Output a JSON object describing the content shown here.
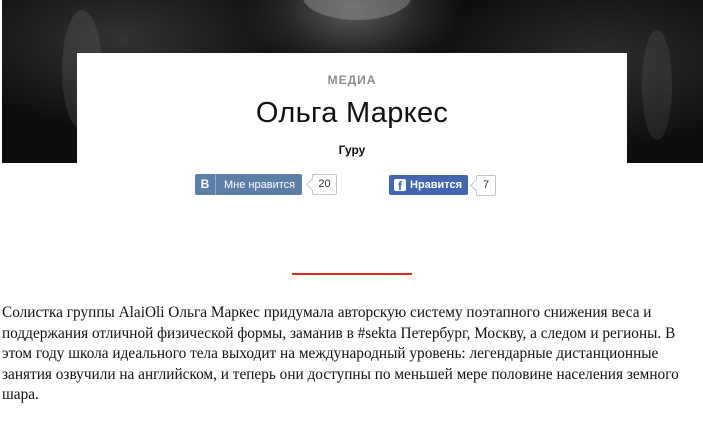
{
  "article": {
    "category": "МЕДИА",
    "title": "Ольга Маркес",
    "subtitle": "Гуру",
    "body": "Солистка группы AlaiOli Ольга Маркес придумала авторскую систему поэтапного снижения веса и поддержания отличной физической формы, заманив в #sekta Петербург, Москву, а следом и регионы. В этом году школа идеального тела выходит на международный уровень: легендарные дистанционные занятия озвучили на английском, и теперь они доступны по меньшей мере половине населения земного шара."
  },
  "share": {
    "vk": {
      "logo": "B",
      "label": "Мне нравится",
      "count": "20"
    },
    "fb": {
      "logo": "f",
      "label": "Нравится",
      "count": "7"
    }
  },
  "colors": {
    "accent_line": "#e0271e",
    "vk": "#5b7fa6",
    "fb": "#4267b2"
  }
}
